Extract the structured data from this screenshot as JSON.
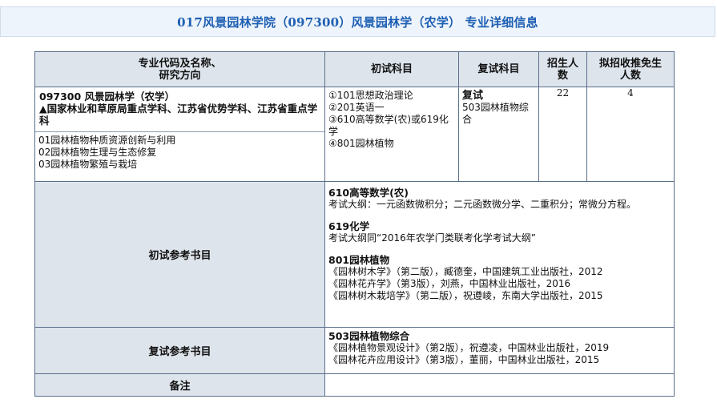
{
  "header": {
    "title": "017风景园林学院（097300）风景园林学（农学） 专业详细信息"
  },
  "table": {
    "col_major": "专业代码及名称、研究方向",
    "col_major_l1": "专业代码及名称、",
    "col_major_l2": "研究方向",
    "col_exam1": "初试科目",
    "col_exam2": "复试科目",
    "col_enroll": "招生人数",
    "col_enroll_l1": "招生人",
    "col_enroll_l2": "数",
    "col_exempt": "拟招收推免生人数",
    "col_exempt_l1": "拟招收推免生",
    "col_exempt_l2": "人数",
    "major_code_name": "097300 风景园林学（农学）",
    "major_note": "▲国家林业和草原局重点学科、江苏省优势学科、江苏省重点学科",
    "directions": [
      "01园林植物种质资源创新与利用",
      "02园林植物生理与生态修复",
      "03园林植物繁殖与栽培"
    ],
    "exam1_subjects": [
      "①101思想政治理论",
      "②201英语一",
      "③610高等数学(农)或619化学",
      "④801园林植物"
    ],
    "exam2_title": "复试",
    "exam2_subject": "503园林植物综合",
    "enroll": "22",
    "exempt": "4"
  },
  "initial_refs": {
    "label": "初试参考书目",
    "groups": [
      {
        "title": "610高等数学(农)",
        "lines": [
          "考试大纲：一元函数微积分；二元函数微分学、二重积分；常微分方程。"
        ]
      },
      {
        "title": "619化学",
        "lines": [
          "考试大纲同“2016年农学门类联考化学考试大纲”"
        ]
      },
      {
        "title": "801园林植物",
        "lines": [
          "《园林树木学》（第二版），臧德奎，中国建筑工业出版社，2012",
          "《园林花卉学》（第3版），刘燕，中国林业出版社，2016",
          "《园林树木栽培学》（第二版），祝遵崚，东南大学出版社，2015"
        ]
      }
    ]
  },
  "retest_refs": {
    "label": "复试参考书目",
    "title": "503园林植物综合",
    "lines": [
      "《园林植物景观设计》（第2版），祝遵凌，中国林业出版社，2019",
      "《园林花卉应用设计》（第3版），董丽，中国林业出版社，2015"
    ]
  },
  "remarks": {
    "label": "备注",
    "value": ""
  }
}
